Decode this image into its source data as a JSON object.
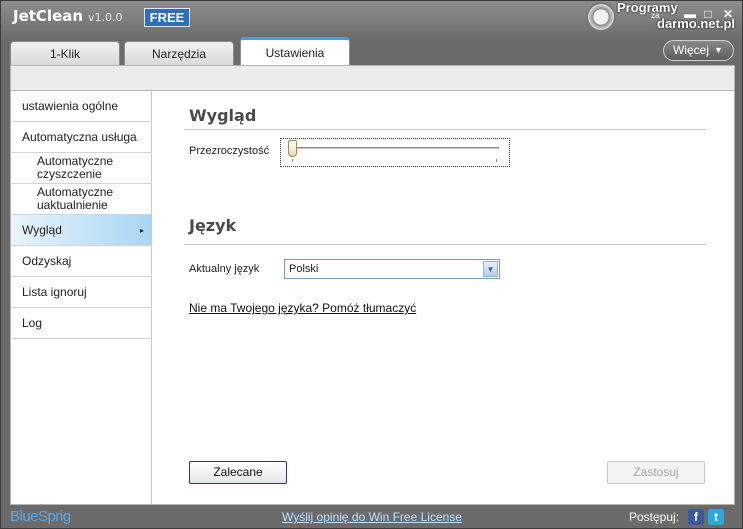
{
  "app": {
    "name": "JetClean",
    "version": "v1.0.0",
    "badge": "FREE",
    "watermark": {
      "line1": "Programy",
      "line2": "za",
      "line3": "darmo.net.pl"
    }
  },
  "window_controls": {
    "minimize": "▬",
    "maximize": "□",
    "close": "✕"
  },
  "tabs": [
    {
      "label": "1-Klik"
    },
    {
      "label": "Narzędzia"
    },
    {
      "label": "Ustawienia",
      "active": true
    }
  ],
  "more_button": {
    "label": "Więcej",
    "caret": "▼"
  },
  "sidebar": {
    "items": [
      {
        "label": "ustawienia ogólne"
      },
      {
        "label": "Automatyczna usługa"
      },
      {
        "label": "Automatyczne czyszczenie"
      },
      {
        "label": "Automatyczne uaktualnienie"
      },
      {
        "label": "Wygląd",
        "active": true
      },
      {
        "label": "Odzyskaj"
      },
      {
        "label": "Lista ignoruj"
      },
      {
        "label": "Log"
      }
    ],
    "arrow": "▸"
  },
  "main": {
    "appearance": {
      "title": "Wygląd",
      "transparency_label": "Przezroczystość",
      "transparency_value": 0
    },
    "language": {
      "title": "Język",
      "current_label": "Aktualny język",
      "selected": "Polski",
      "help_link": "Nie ma Twojego języka? Pomóż tłumaczyć"
    },
    "buttons": {
      "recommended": "Zalecane",
      "apply": "Zastosuj"
    }
  },
  "footer": {
    "brand": "BlueSprig",
    "feedback_link": "Wyślij opinię do Win Free License",
    "follow_label": "Postępuj:",
    "facebook_glyph": "f",
    "twitter_glyph": "t"
  },
  "colors": {
    "accent": "#3aa0e8",
    "badge": "#2f6fb8",
    "active_item": "#a8d6f4"
  }
}
